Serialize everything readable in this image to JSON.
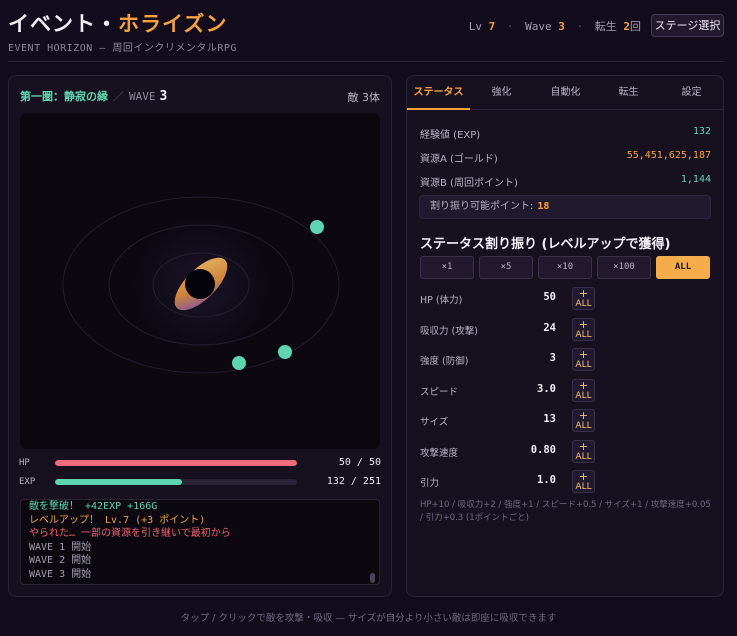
{
  "header": {
    "title_main": "イベント・",
    "title_accent": "ホライズン",
    "subtitle": "EVENT HORIZON — 周回インクリメンタルRPG",
    "lv_label": "Lv",
    "lv_value": "7",
    "wave_label": "Wave",
    "wave_value": "3",
    "rebirth_label": "転生",
    "rebirth_value": "2",
    "rebirth_suffix": "回",
    "sep": "·",
    "stage_button": "ステージ選択"
  },
  "battle": {
    "area_name": "第一圏：静寂の縁",
    "slash": "／",
    "wave_word": "WAVE",
    "wave_number": "3",
    "enemy_count": "敵 3体",
    "enemies": 3
  },
  "bars": {
    "hp_label": "HP",
    "hp_text": "50 / 50",
    "hp_fraction": 1.0,
    "exp_label": "EXP",
    "exp_text": "132 / 251",
    "exp_fraction": 0.526
  },
  "log": [
    {
      "text": "敵を撃破！ +42EXP +166G",
      "color": "#5fd4b0"
    },
    {
      "text": "レベルアップ！ Lv.7 (+3 ポイント)",
      "color": "#f5a23c"
    },
    {
      "text": "やられた… 一部の資源を引き継いで最初から",
      "color": "#f06070"
    },
    {
      "text": "WAVE 1 開始",
      "color": "#a39cae"
    },
    {
      "text": "WAVE 2 開始",
      "color": "#a39cae"
    },
    {
      "text": "WAVE 3 開始",
      "color": "#a39cae"
    }
  ],
  "tabs": [
    {
      "label": "ステータス",
      "active": true
    },
    {
      "label": "強化",
      "active": false
    },
    {
      "label": "自動化",
      "active": false
    },
    {
      "label": "転生",
      "active": false
    },
    {
      "label": "設定",
      "active": false
    }
  ],
  "stats": {
    "exp_label": "経験値 (EXP)",
    "exp_value": "132",
    "gold_label": "資源A (ゴールド)",
    "gold_value": "55,451,625,187",
    "loop_label": "資源B (周回ポイント)",
    "loop_value": "1,144",
    "points_label": "割り振り可能ポイント:",
    "points_value": "18"
  },
  "allocation": {
    "title": "ステータス割り振り (レベルアップで獲得)",
    "multipliers": [
      {
        "label": "×1",
        "active": false
      },
      {
        "label": "×5",
        "active": false
      },
      {
        "label": "×10",
        "active": false
      },
      {
        "label": "×100",
        "active": false
      },
      {
        "label": "ALL",
        "active": true
      }
    ],
    "plus_top": "+",
    "plus_bottom": "ALL",
    "attributes": [
      {
        "label": "HP (体力)",
        "value": "50"
      },
      {
        "label": "吸収力 (攻撃)",
        "value": "24"
      },
      {
        "label": "強度 (防御)",
        "value": "3"
      },
      {
        "label": "スピード",
        "value": "3.0"
      },
      {
        "label": "サイズ",
        "value": "13"
      },
      {
        "label": "攻撃速度",
        "value": "0.80"
      },
      {
        "label": "引力",
        "value": "1.0"
      }
    ],
    "note": "HP+10 / 吸収力+2 / 強度+1 / スピード+0.5 / サイズ+1 / 攻撃速度+0.05 / 引力+0.3 (1ポイントごと)"
  },
  "footer": "タップ / クリックで敵を攻撃・吸収 — サイズが自分より小さい敵は即座に吸収できます",
  "colors": {
    "accent": "#f5a23c",
    "teal": "#5fd4b0",
    "hp_bar": "#f06b7e",
    "exp_bar": "#5fd4b0"
  }
}
